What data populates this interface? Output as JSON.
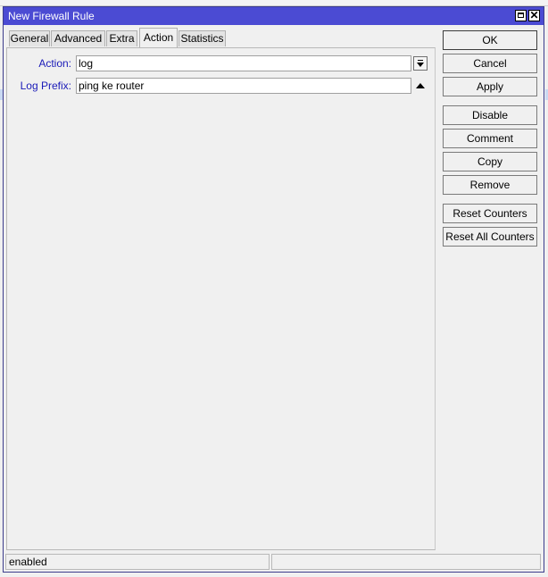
{
  "window": {
    "title": "New Firewall Rule"
  },
  "tabs": [
    {
      "label": "General"
    },
    {
      "label": "Advanced"
    },
    {
      "label": "Extra"
    },
    {
      "label": "Action"
    },
    {
      "label": "Statistics"
    }
  ],
  "active_tab": "Action",
  "form": {
    "action": {
      "label": "Action:",
      "value": "log"
    },
    "log_prefix": {
      "label": "Log Prefix:",
      "value": "ping ke router"
    }
  },
  "buttons": {
    "ok": "OK",
    "cancel": "Cancel",
    "apply": "Apply",
    "disable": "Disable",
    "comment": "Comment",
    "copy": "Copy",
    "remove": "Remove",
    "reset_counters": "Reset Counters",
    "reset_all_counters": "Reset All Counters"
  },
  "status": {
    "state": "enabled",
    "secondary": ""
  },
  "colors": {
    "titlebar": "#4b4bd3",
    "label_text": "#1a1ab8",
    "window_bg": "#f0f0f0"
  }
}
